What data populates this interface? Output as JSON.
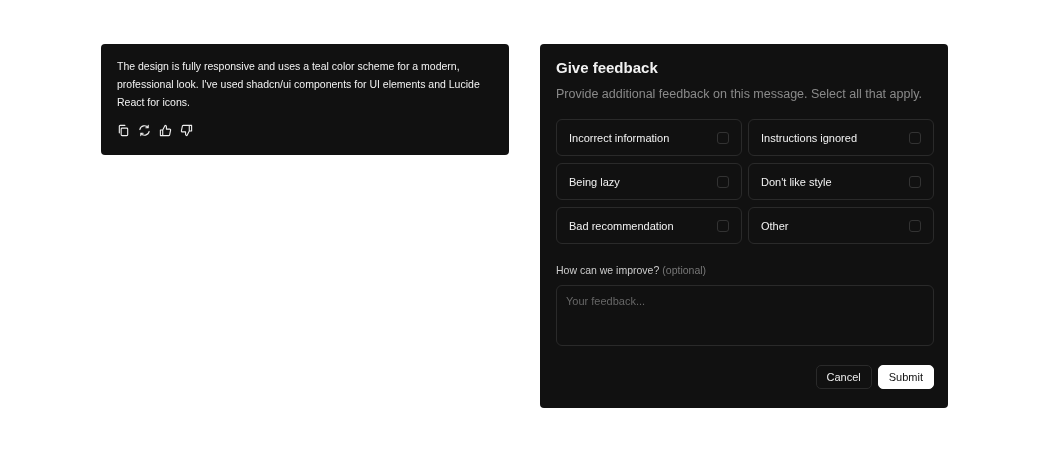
{
  "message": {
    "text": "The design is fully responsive and uses a teal color scheme for a modern, professional look. I've used shadcn/ui components for UI elements and Lucide React for icons.",
    "actions": [
      {
        "kind": "copy"
      },
      {
        "kind": "regenerate"
      },
      {
        "kind": "like"
      },
      {
        "kind": "dislike"
      }
    ]
  },
  "dialog": {
    "title": "Give feedback",
    "description": "Provide additional feedback on this message. Select all that apply.",
    "options": [
      {
        "label": "Incorrect information",
        "checked": false
      },
      {
        "label": "Instructions ignored",
        "checked": false
      },
      {
        "label": "Being lazy",
        "checked": false
      },
      {
        "label": "Don't like style",
        "checked": false
      },
      {
        "label": "Bad recommendation",
        "checked": false
      },
      {
        "label": "Other",
        "checked": false
      }
    ],
    "improve_label": "How can we improve?",
    "improve_hint": "(optional)",
    "placeholder": "Your feedback...",
    "buttons": [
      {
        "label": "Cancel",
        "kind": "secondary"
      },
      {
        "label": "Submit",
        "kind": "primary"
      }
    ]
  }
}
